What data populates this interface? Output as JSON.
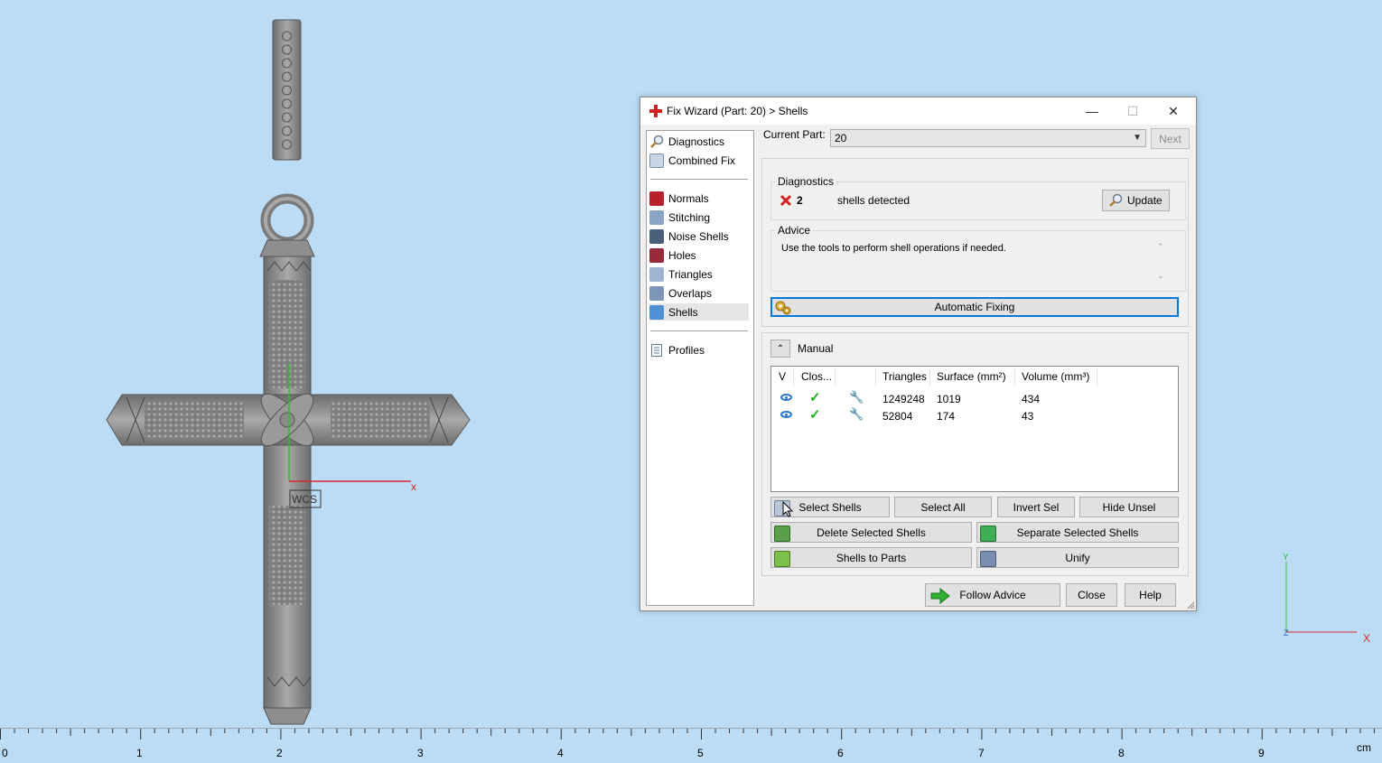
{
  "window": {
    "title": "Fix Wizard (Part: 20) > Shells",
    "minimize": "—",
    "maximize": "☐",
    "close": "✕"
  },
  "nav": {
    "group1": [
      {
        "label": "Diagnostics",
        "icon": "magnifier-icon"
      },
      {
        "label": "Combined Fix",
        "icon": "combined-fix-icon"
      }
    ],
    "group2": [
      {
        "label": "Normals",
        "icon": "normals-icon"
      },
      {
        "label": "Stitching",
        "icon": "stitching-icon"
      },
      {
        "label": "Noise Shells",
        "icon": "noise-shells-icon"
      },
      {
        "label": "Holes",
        "icon": "holes-icon"
      },
      {
        "label": "Triangles",
        "icon": "triangles-icon"
      },
      {
        "label": "Overlaps",
        "icon": "overlaps-icon"
      },
      {
        "label": "Shells",
        "icon": "shells-icon",
        "selected": true
      }
    ],
    "group3": [
      {
        "label": "Profiles",
        "icon": "profiles-icon"
      }
    ]
  },
  "current_part": {
    "label": "Current Part:",
    "value": "20",
    "next_label": "Next"
  },
  "diagnostics": {
    "legend": "Diagnostics",
    "count": "2",
    "message": "shells detected",
    "update_label": "Update"
  },
  "advice": {
    "legend": "Advice",
    "text": "Use the tools to perform shell operations if needed."
  },
  "automatic_fixing_label": "Automatic Fixing",
  "manual": {
    "label": "Manual",
    "collapse_glyph": "⌃",
    "columns": {
      "v": "V",
      "closed": "Clos...",
      "triangles": "Triangles",
      "surface": "Surface (mm²)",
      "volume": "Volume (mm³)"
    },
    "rows": [
      {
        "triangles": "1249248",
        "surface": "1019",
        "volume": "434"
      },
      {
        "triangles": "52804",
        "surface": "174",
        "volume": "43"
      }
    ],
    "buttons": {
      "select_shells": "Select Shells",
      "select_all": "Select All",
      "invert_sel": "Invert Sel",
      "hide_unsel": "Hide Unsel",
      "delete_selected": "Delete Selected Shells",
      "separate_selected": "Separate Selected Shells",
      "shells_to_parts": "Shells to Parts",
      "unify": "Unify"
    }
  },
  "footer": {
    "follow_advice": "Follow Advice",
    "close": "Close",
    "help": "Help"
  },
  "viewport": {
    "wcs_label": "WCS",
    "axis_x": "x",
    "triad_x": "X",
    "triad_y": "Y",
    "triad_z": "Z"
  },
  "ruler": {
    "labels": [
      "0",
      "1",
      "2",
      "3",
      "4",
      "5",
      "6",
      "7",
      "8",
      "9"
    ],
    "unit": "cm"
  },
  "colors": {
    "background": "#bcdcf6",
    "accent": "#0078d7",
    "error_red": "#d32020",
    "ok_green": "#1bb01b"
  }
}
